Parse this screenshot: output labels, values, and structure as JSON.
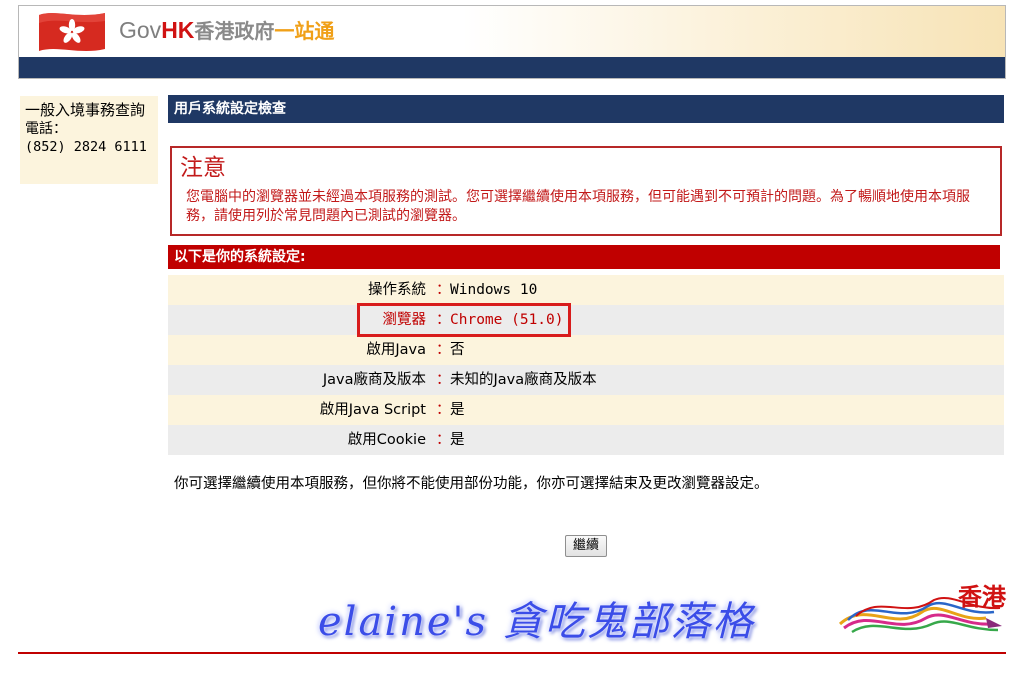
{
  "header": {
    "logo_gov": "Gov",
    "logo_hk": "HK",
    "logo_name": "香港政府",
    "logo_onestop": "一站通"
  },
  "side": {
    "title": "一般入境事務查詢",
    "phone_label": "電話：",
    "phone_number": "(852) 2824 6111"
  },
  "section_title": "用戶系統設定檢查",
  "notice": {
    "title": "注意",
    "body": "您電腦中的瀏覽器並未經過本項服務的測試。您可選擇繼續使用本項服務，但可能遇到不可預計的問題。為了暢順地使用本項服務，請使用列於常見問題內已測試的瀏覽器。"
  },
  "settings": {
    "title": "以下是你的系統設定:",
    "separator": "：",
    "rows": [
      {
        "label": "操作系統",
        "value": "Windows 10"
      },
      {
        "label": "瀏覽器",
        "value": "Chrome (51.0)"
      },
      {
        "label": "啟用Java",
        "value": "否"
      },
      {
        "label": "Java廠商及版本",
        "value": "未知的Java廠商及版本"
      },
      {
        "label": "啟用Java Script",
        "value": "是"
      },
      {
        "label": "啟用Cookie",
        "value": "是"
      }
    ]
  },
  "instruction": "你可選擇繼續使用本項服務，但你將不能使用部份功能，你亦可選擇結束及更改瀏覽器設定。",
  "continue_label": "繼續",
  "watermark": "elaine's 貪吃鬼部落格",
  "brandhk_text": "香港",
  "colors": {
    "navy": "#1f3864",
    "red": "#c00000",
    "cream": "#fcf4dd",
    "gray_row": "#ececec"
  }
}
